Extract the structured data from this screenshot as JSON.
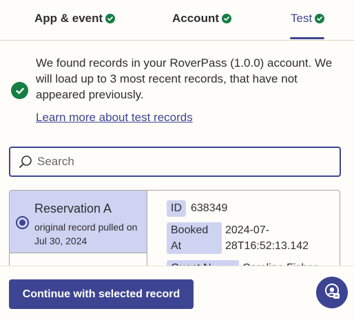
{
  "tabs": [
    {
      "label": "App & event",
      "done": true
    },
    {
      "label": "Account",
      "done": true
    },
    {
      "label": "Test",
      "done": true,
      "active": true
    }
  ],
  "notice": {
    "text": "We found records in your RoverPass (1.0.0) account. We will load up to 3 most recent records, that have not appeared previously.",
    "link": "Learn more about test records"
  },
  "search": {
    "placeholder": "Search",
    "value": ""
  },
  "records": [
    {
      "title": "Reservation A",
      "subtitle": "original record pulled on Jul 30, 2024",
      "selected": true
    }
  ],
  "details": [
    {
      "key": "ID",
      "value": "638349"
    },
    {
      "key": "Booked At",
      "value": "2024-07-28T16:52:13.142"
    },
    {
      "key": "Guest N...",
      "value": "Caroline Fisher"
    }
  ],
  "actions": {
    "continue_label": "Continue with selected record"
  },
  "colors": {
    "primary": "#3d4592",
    "success": "#137f43",
    "selected_bg": "#cfd3f2",
    "page_bg": "#fffdf9"
  }
}
